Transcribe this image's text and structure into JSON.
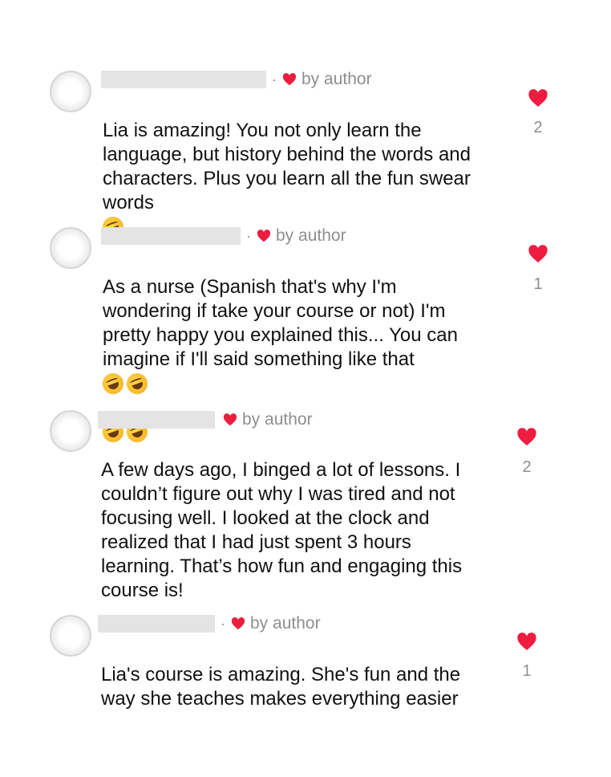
{
  "colors": {
    "heart": "#ee1d3f",
    "meta_text": "#8e8e8e",
    "body_text": "#111111"
  },
  "comments": [
    {
      "author_label": "by author",
      "text": "Lia is amazing! You not only learn the\nlanguage, but history behind the words and\ncharacters. Plus you learn all the fun swear\nwords",
      "emoji_trailing": [
        "rolling-on-floor-laughing-emoji"
      ],
      "like_count": "2"
    },
    {
      "author_label": "by author",
      "text": "As a nurse (Spanish that's why I'm\nwondering if take your course or not) I'm\npretty happy you explained this... You can\nimagine if I'll said something like that",
      "emoji_trailing": [
        "rolling-on-floor-laughing-emoji",
        "rolling-on-floor-laughing-emoji",
        "rolling-on-floor-laughing-emoji",
        "rolling-on-floor-laughing-emoji"
      ],
      "like_count": "1"
    },
    {
      "author_label": "by author",
      "text": "A few days ago, I binged a lot of lessons. I\ncouldn’t figure out why I was tired and not\nfocusing well. I looked at the clock and\nrealized that I had just spent 3 hours\nlearning. That’s how fun and engaging this\ncourse is!",
      "emoji_trailing": [],
      "like_count": "2"
    },
    {
      "author_label": "by author",
      "text": "Lia's course is amazing. She's fun and the\nway she teaches makes everything easier",
      "emoji_trailing": [],
      "like_count": "1"
    }
  ]
}
